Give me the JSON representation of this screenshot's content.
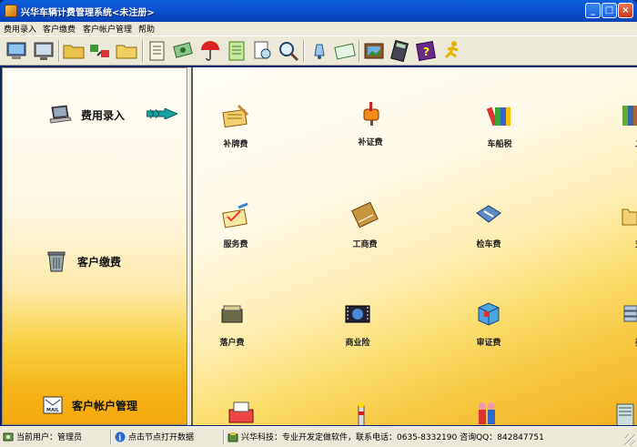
{
  "window": {
    "title": "兴华车辆计费管理系统<未注册>",
    "controls": {
      "minimize": "_",
      "maximize": "□",
      "close": "×"
    }
  },
  "menu": {
    "items": [
      "费用录入",
      "客户缴费",
      "客户帐户管理",
      "帮助"
    ]
  },
  "toolbar": {
    "buttons": [
      "monitor-icon",
      "screen-icon",
      "folder-icon",
      "exchange-icon",
      "folder-open-icon",
      "notes-icon",
      "money-icon",
      "umbrella-icon",
      "notebook-icon",
      "find-doc-icon",
      "search-icon",
      "bell-icon",
      "envelope-icon",
      "picture-icon",
      "calculator-icon",
      "help-book-icon",
      "runner-icon"
    ]
  },
  "left_panel": {
    "items": [
      {
        "label": "费用录入",
        "icon": "laptop-icon"
      },
      {
        "label": "客户缴费",
        "icon": "recycle-bin-icon"
      },
      {
        "label": "客户帐户管理",
        "icon": "mail-icon"
      }
    ]
  },
  "grid": {
    "rows": [
      [
        "补牌费",
        "补证费",
        "车船税",
        "二保"
      ],
      [
        "服务费",
        "工商费",
        "检车费",
        "交强"
      ],
      [
        "落户费",
        "商业险",
        "审证费",
        "养路"
      ]
    ],
    "bottom_icons": [
      "printer-icon",
      "lighthouse-icon",
      "people-icon",
      "server-icon"
    ]
  },
  "status": {
    "user": "当前用户：管理员",
    "hint": "点击节点打开数据",
    "company": "兴华科技：专业开发定做软件，联系电话：0635-8332190    咨询QQ：842847751"
  },
  "colors": {
    "titlebar": "#0a4ac4",
    "panel_top": "#fffdf6",
    "panel_bottom": "#f3a80e"
  }
}
